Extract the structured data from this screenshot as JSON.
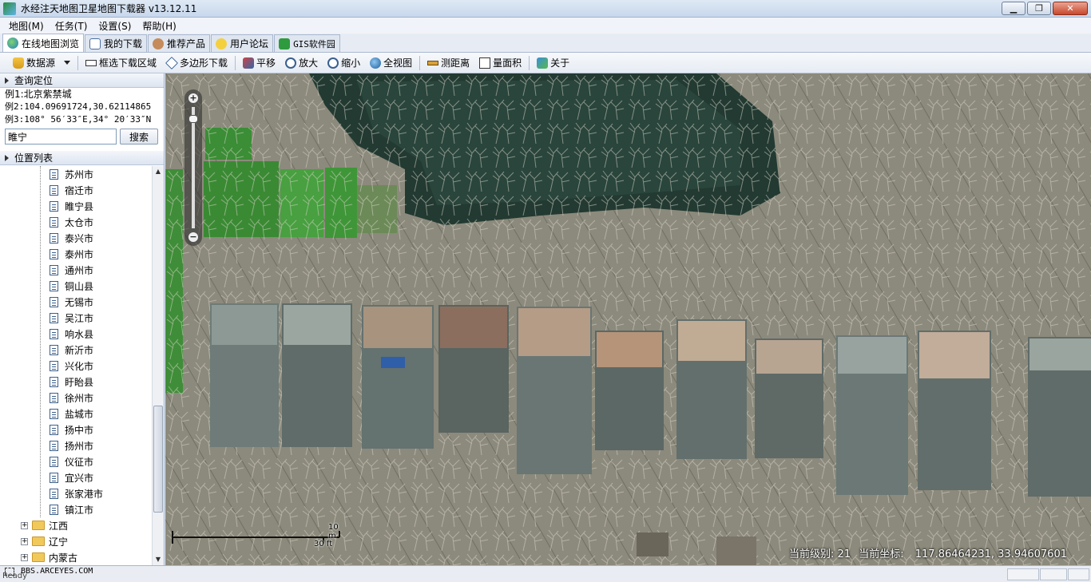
{
  "window": {
    "title": "水经注天地图卫星地图下载器 v13.12.11"
  },
  "menu": [
    "地图(M)",
    "任务(T)",
    "设置(S)",
    "帮助(H)"
  ],
  "tabs": [
    {
      "label": "在线地图浏览",
      "active": true
    },
    {
      "label": "我的下载"
    },
    {
      "label": "推荐产品"
    },
    {
      "label": "用户论坛"
    },
    {
      "label": "GIS软件园"
    }
  ],
  "toolbar": {
    "datasource": "数据源",
    "box_download": "框选下载区域",
    "polygon_download": "多边形下载",
    "pan": "平移",
    "zoom_in": "放大",
    "zoom_out": "缩小",
    "full_view": "全视图",
    "measure_distance": "测距离",
    "measure_area": "量面积",
    "about": "关于"
  },
  "query": {
    "title": "查询定位",
    "example1": "例1:北京紫禁城",
    "example2": "例2:104.09691724,30.62114865",
    "example3": "例3:108° 56′33″E,34° 20′33″N",
    "input_value": "睢宁",
    "search_label": "搜索"
  },
  "location_list": {
    "title": "位置列表",
    "cities": [
      "苏州市",
      "宿迁市",
      "睢宁县",
      "太仓市",
      "泰兴市",
      "泰州市",
      "通州市",
      "铜山县",
      "无锡市",
      "吴江市",
      "响水县",
      "新沂市",
      "兴化市",
      "盱眙县",
      "徐州市",
      "盐城市",
      "扬中市",
      "扬州市",
      "仪征市",
      "宜兴市",
      "张家港市",
      "镇江市"
    ],
    "provinces": [
      "江西",
      "辽宁",
      "内蒙古"
    ]
  },
  "map": {
    "scale_m": "10 m",
    "scale_ft": "30 ft",
    "level_label": "当前级别:",
    "level_value": "21",
    "coord_label": "当前坐标:",
    "coord_value": "117.86464231, 33.94607601"
  },
  "status": {
    "url": "BBS.ARCEYES.COM",
    "ready": "Ready"
  }
}
